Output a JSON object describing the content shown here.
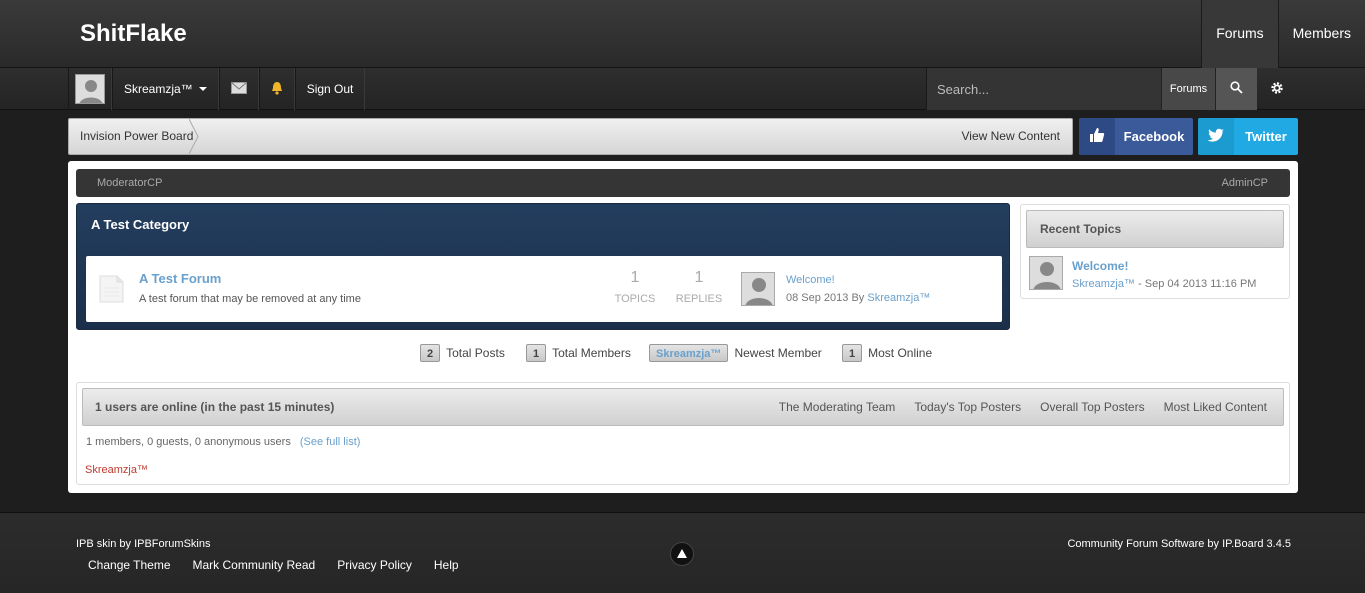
{
  "header": {
    "logo": "ShitFlake",
    "nav": [
      {
        "label": "Forums",
        "active": true
      },
      {
        "label": "Members",
        "active": false
      }
    ]
  },
  "userbar": {
    "username": "Skreamzja™",
    "sign_out": "Sign Out",
    "search_placeholder": "Search...",
    "search_scope": "Forums"
  },
  "breadcrumb": {
    "home": "Invision Power Board",
    "view_new": "View New Content"
  },
  "social": {
    "facebook": "Facebook",
    "twitter": "Twitter"
  },
  "modbar": {
    "moderator": "ModeratorCP",
    "admin": "AdminCP"
  },
  "category": {
    "title": "A Test Category",
    "forum": {
      "name": "A Test Forum",
      "description": "A test forum that may be removed at any time",
      "topics": "1",
      "topics_label": "TOPICS",
      "replies": "1",
      "replies_label": "REPLIES",
      "last_post_title": "Welcome!",
      "last_post_date": "08 Sep 2013",
      "last_post_by": "By",
      "last_post_user": "Skreamzja™"
    }
  },
  "recent_topics": {
    "title": "Recent Topics",
    "items": [
      {
        "title": "Welcome!",
        "user": "Skreamzja™",
        "date": " - Sep 04 2013 11:16 PM"
      }
    ]
  },
  "stats": {
    "total_posts": "2",
    "total_posts_label": "Total Posts",
    "total_members": "1",
    "total_members_label": "Total Members",
    "newest_member": "Skreamzja™",
    "newest_member_label": "Newest Member",
    "most_online": "1",
    "most_online_label": "Most Online"
  },
  "online": {
    "title": "1 users are online (in the past 15 minutes)",
    "links": [
      "The Moderating Team",
      "Today's Top Posters",
      "Overall Top Posters",
      "Most Liked Content"
    ],
    "count": "1 members, 0 guests, 0 anonymous users",
    "full_list": "(See full list)",
    "users": [
      "Skreamzja™"
    ]
  },
  "footer": {
    "skin": "IPB skin by IPBForumSkins",
    "links": [
      "Change Theme",
      "Mark Community Read",
      "Privacy Policy",
      "Help"
    ],
    "copyright": "Community Forum Software by IP.Board 3.4.5"
  },
  "colors": {
    "accent_link": "#6aa0cc",
    "category_bg": "#1f3653",
    "facebook": "#3b5a9a",
    "twitter": "#20a9e3",
    "online_user": "#c0392b"
  }
}
